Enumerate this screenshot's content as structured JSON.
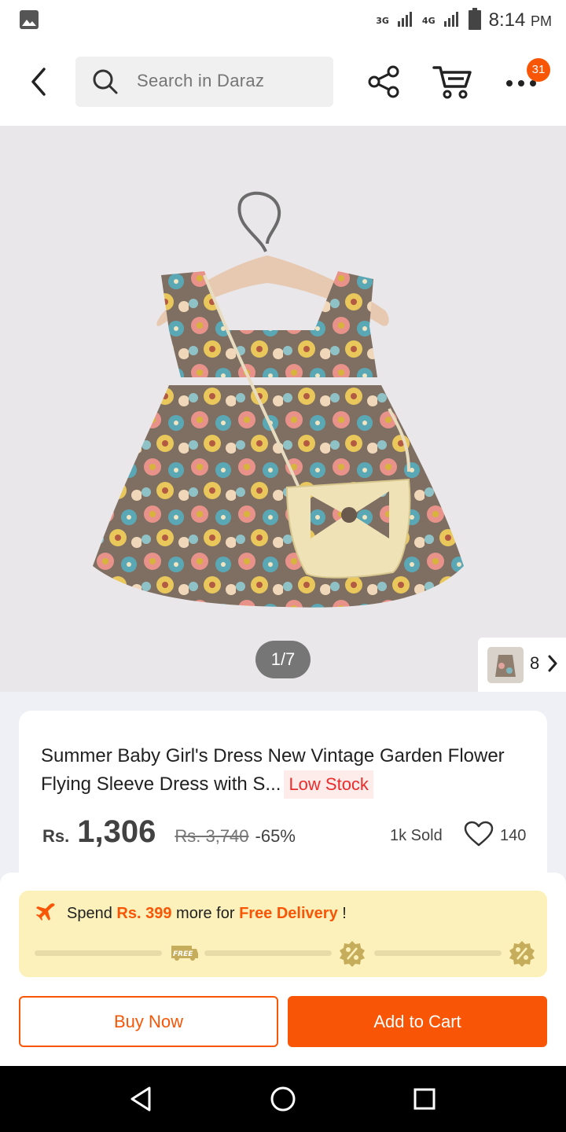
{
  "status_bar": {
    "network_1": "3G",
    "network_2": "4G",
    "time": "8:14",
    "ampm": "PM"
  },
  "header": {
    "search_placeholder": "Search in Daraz",
    "cart_badge": "31"
  },
  "product": {
    "image_counter": "1/7",
    "variant_count": "8",
    "title": "Summer Baby Girl's Dress New Vintage Garden Flower Flying Sleeve Dress with S...",
    "stock_badge": "Low Stock",
    "price_currency": "Rs.",
    "price": "1,306",
    "original_price": "Rs. 3,740",
    "discount": "-65%",
    "sold": "1k Sold",
    "wishlist_count": "140"
  },
  "delivery": {
    "spend_text": "Spend",
    "amount": "Rs. 399",
    "more_for": "more for",
    "free_delivery": "Free Delivery",
    "exclaim": "!",
    "free_tag": "FREE",
    "progress": 0
  },
  "actions": {
    "buy_now": "Buy Now",
    "add_to_cart": "Add to Cart"
  },
  "colors": {
    "accent": "#f85606",
    "banner": "#fdf1bb",
    "low_stock": "#ec2b2b"
  }
}
